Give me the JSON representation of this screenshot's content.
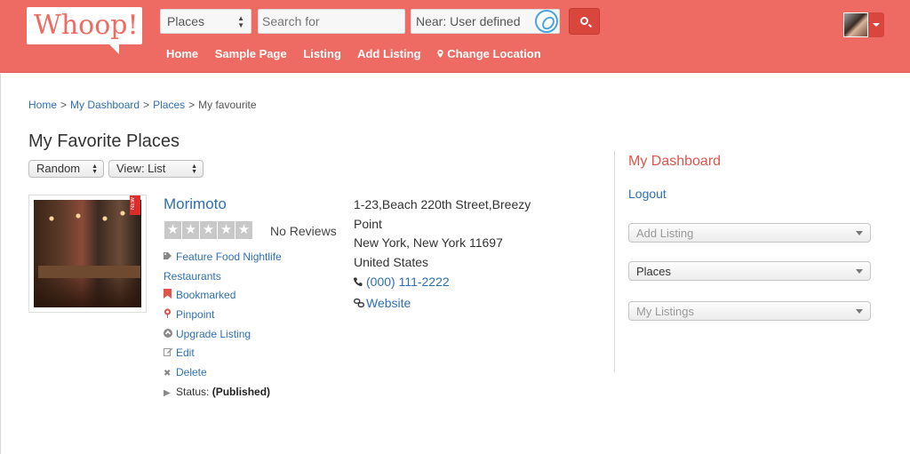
{
  "header": {
    "logo_text": "Whoop!",
    "category_select": "Places",
    "search_placeholder": "Search for",
    "near_value": "Near: User defined",
    "nav": [
      "Home",
      "Sample Page",
      "Listing",
      "Add Listing",
      "Change Location"
    ],
    "accent_color": "#ee6b63"
  },
  "breadcrumb": {
    "items": [
      "Home",
      "My Dashboard",
      "Places"
    ],
    "current": "My favourite",
    "separator": ">"
  },
  "page": {
    "title": "My Favorite Places",
    "sort_select": "Random",
    "view_select": "View: List"
  },
  "listing": {
    "name": "Morimoto",
    "rating_stars": 0,
    "reviews_text": "No Reviews",
    "tags_line1": "Feature  Food Nightlife",
    "tags_line2": "Restaurants",
    "bookmarked": "Bookmarked",
    "pinpoint": "Pinpoint",
    "upgrade": "Upgrade Listing",
    "edit": "Edit",
    "delete": "Delete",
    "status_label": "Status:",
    "status_value": "(Published)",
    "address_line1": "1-23,Beach 220th Street,Breezy",
    "address_line2": "Point",
    "address_line3": "New York, New York 11697",
    "address_line4": "United States",
    "phone": "(000) 111-2222",
    "website": "Website",
    "ribbon_text": "NEW"
  },
  "sidebar": {
    "title": "My Dashboard",
    "logout": "Logout",
    "selects": [
      "Add Listing",
      "Places",
      "My Listings"
    ]
  }
}
